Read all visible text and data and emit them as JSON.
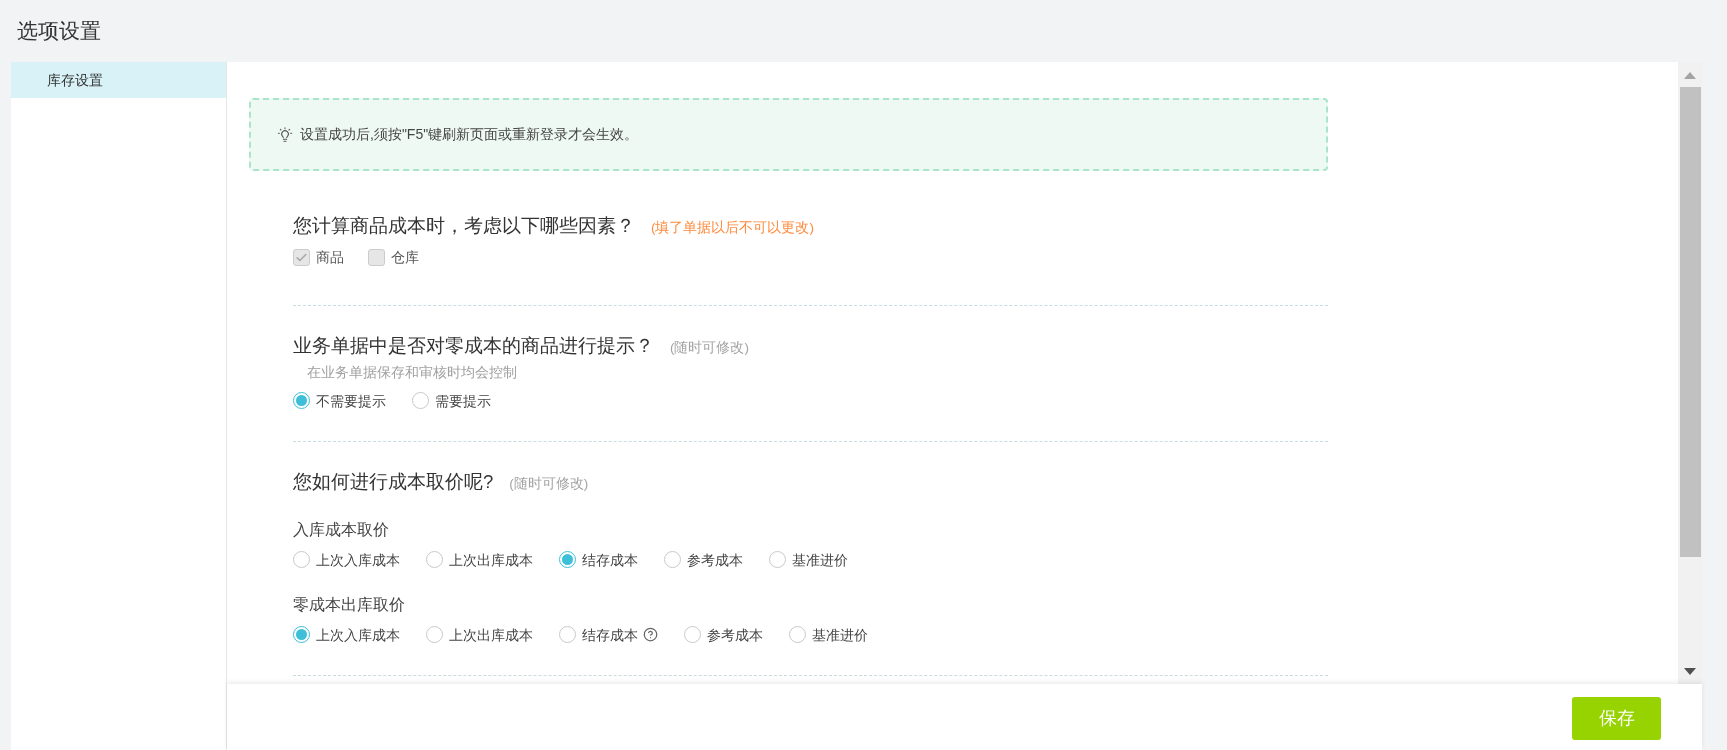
{
  "page": {
    "title": "选项设置"
  },
  "sidebar": {
    "items": [
      {
        "label": "库存设置",
        "selected": true
      }
    ]
  },
  "notice": {
    "text": "设置成功后,须按\"F5\"键刷新页面或重新登录才会生效。"
  },
  "sections": [
    {
      "title": "您计算商品成本时，考虑以下哪些因素？",
      "note": {
        "text": "(填了单据以后不可以更改)",
        "kind": "warning"
      },
      "groups": [
        {
          "kind": "checkbox",
          "options": [
            {
              "label": "商品",
              "checked": true,
              "disabled": true
            },
            {
              "label": "仓库",
              "checked": false,
              "disabled": true
            }
          ]
        }
      ]
    },
    {
      "title": "业务单据中是否对零成本的商品进行提示？",
      "note": {
        "text": "(随时可修改)",
        "kind": "hint"
      },
      "hint": "在业务单据保存和审核时均会控制",
      "groups": [
        {
          "kind": "radio",
          "options": [
            {
              "label": "不需要提示",
              "selected": true
            },
            {
              "label": "需要提示",
              "selected": false
            }
          ]
        }
      ]
    },
    {
      "title": "您如何进行成本取价呢?",
      "note": {
        "text": "(随时可修改)",
        "kind": "hint"
      },
      "groups": [
        {
          "kind": "radio",
          "label": "入库成本取价",
          "options": [
            {
              "label": "上次入库成本",
              "selected": false
            },
            {
              "label": "上次出库成本",
              "selected": false
            },
            {
              "label": "结存成本",
              "selected": true
            },
            {
              "label": "参考成本",
              "selected": false
            },
            {
              "label": "基准进价",
              "selected": false
            }
          ]
        },
        {
          "kind": "radio",
          "label": "零成本出库取价",
          "options": [
            {
              "label": "上次入库成本",
              "selected": true,
              "help": false
            },
            {
              "label": "上次出库成本",
              "selected": false,
              "help": false
            },
            {
              "label": "结存成本",
              "selected": false,
              "help": true
            },
            {
              "label": "参考成本",
              "selected": false,
              "help": false
            },
            {
              "label": "基准进价",
              "selected": false,
              "help": false
            }
          ]
        }
      ]
    }
  ],
  "footer": {
    "buttons": [
      {
        "label": "保存"
      }
    ]
  }
}
